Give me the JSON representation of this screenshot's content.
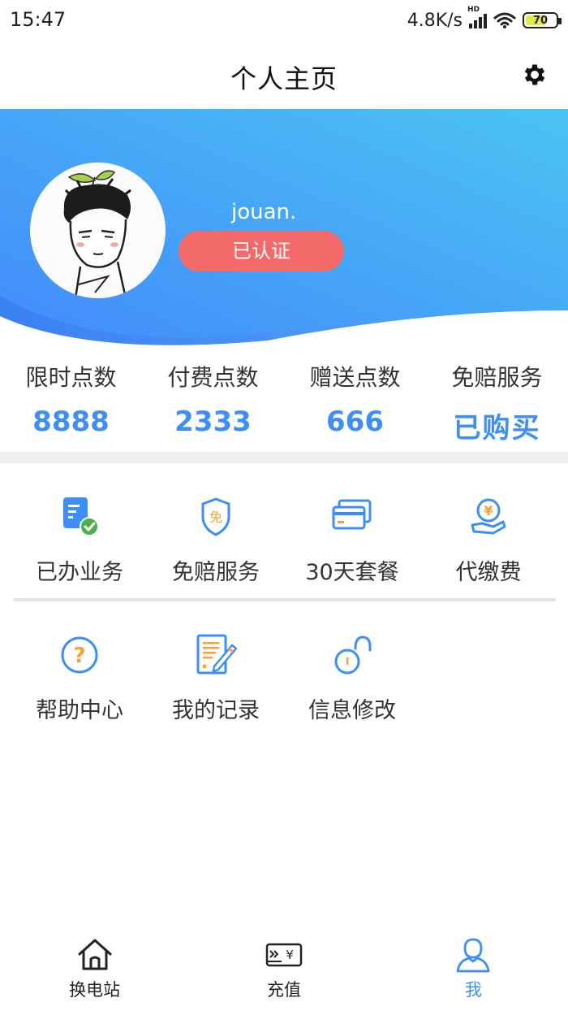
{
  "status_bar": {
    "time": "15:47",
    "network_speed": "4.8K/s",
    "network_type": "HD",
    "battery": "70",
    "battery_level": 0.7
  },
  "header": {
    "title": "个人主页",
    "settings_icon": "gear-icon"
  },
  "profile": {
    "username": "jouan.",
    "verified_label": "已认证",
    "banner_colors": [
      "#4bc3f3",
      "#4289fb"
    ],
    "badge_color": "#f46a6a"
  },
  "stats": [
    {
      "label": "限时点数",
      "value": "8888"
    },
    {
      "label": "付费点数",
      "value": "2333"
    },
    {
      "label": "赠送点数",
      "value": "666"
    },
    {
      "label": "免赔服务",
      "value": "已购买"
    }
  ],
  "features": {
    "row1": [
      {
        "label": "已办业务",
        "icon": "document-check-icon"
      },
      {
        "label": "免赔服务",
        "icon": "shield-icon",
        "badge": "免"
      },
      {
        "label": "30天套餐",
        "icon": "cards-icon"
      },
      {
        "label": "代缴费",
        "icon": "hand-coin-icon",
        "badge": "¥"
      }
    ],
    "row2": [
      {
        "label": "帮助中心",
        "icon": "help-icon",
        "badge": "?"
      },
      {
        "label": "我的记录",
        "icon": "record-icon"
      },
      {
        "label": "信息修改",
        "icon": "unlock-icon"
      }
    ]
  },
  "bottom_nav": [
    {
      "label": "换电站",
      "icon": "home-icon",
      "active": false
    },
    {
      "label": "充值",
      "icon": "recharge-icon",
      "active": false,
      "badge": "¥"
    },
    {
      "label": "我",
      "icon": "user-icon",
      "active": true
    }
  ],
  "colors": {
    "accent": "#3e8ef7",
    "icon_orange": "#f5a13a",
    "icon_blue": "#3e8ef7",
    "check_green": "#4caf50"
  }
}
